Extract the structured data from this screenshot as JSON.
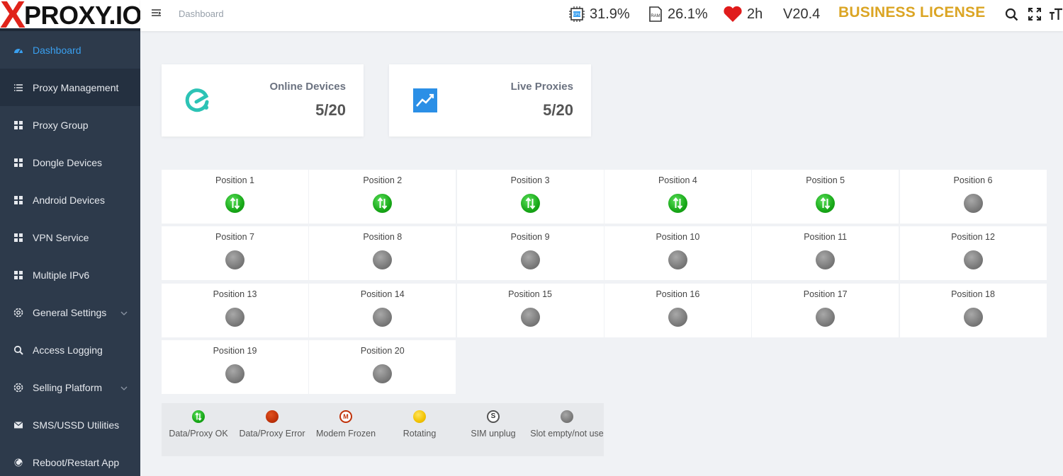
{
  "brand": {
    "logo_x": "X",
    "logo_text": "PROXY.IO"
  },
  "header": {
    "breadcrumb": "Dashboard",
    "cpu": "31.9%",
    "ram": "26.1%",
    "uptime": "2h",
    "version": "V20.4",
    "license": "BUSINESS LICENSE",
    "cpu_chip_label": "CPU",
    "ram_chip_label": "RAM"
  },
  "sidebar": {
    "items": [
      {
        "label": "Dashboard",
        "icon": "dashboard-icon"
      },
      {
        "label": "Proxy Management",
        "icon": "list-icon"
      },
      {
        "label": "Proxy Group",
        "icon": "grid-icon"
      },
      {
        "label": "Dongle Devices",
        "icon": "grid-icon"
      },
      {
        "label": "Android Devices",
        "icon": "grid-icon"
      },
      {
        "label": "VPN Service",
        "icon": "grid-icon"
      },
      {
        "label": "Multiple IPv6",
        "icon": "grid-icon"
      },
      {
        "label": "General Settings",
        "icon": "gear-icon"
      },
      {
        "label": "Access Logging",
        "icon": "search-icon"
      },
      {
        "label": "Selling Platform",
        "icon": "gear-icon"
      },
      {
        "label": "SMS/USSD Utilities",
        "icon": "envelope-icon"
      },
      {
        "label": "Reboot/Restart App",
        "icon": "restart-icon"
      }
    ]
  },
  "cards": {
    "online": {
      "title": "Online Devices",
      "value": "5/20"
    },
    "live": {
      "title": "Live Proxies",
      "value": "5/20"
    }
  },
  "positions": [
    {
      "label": "Position 1",
      "status": "ok"
    },
    {
      "label": "Position 2",
      "status": "ok"
    },
    {
      "label": "Position 3",
      "status": "ok"
    },
    {
      "label": "Position 4",
      "status": "ok"
    },
    {
      "label": "Position 5",
      "status": "ok"
    },
    {
      "label": "Position 6",
      "status": "empty"
    },
    {
      "label": "Position 7",
      "status": "empty"
    },
    {
      "label": "Position 8",
      "status": "empty"
    },
    {
      "label": "Position 9",
      "status": "empty"
    },
    {
      "label": "Position 10",
      "status": "empty"
    },
    {
      "label": "Position 11",
      "status": "empty"
    },
    {
      "label": "Position 12",
      "status": "empty"
    },
    {
      "label": "Position 13",
      "status": "empty"
    },
    {
      "label": "Position 14",
      "status": "empty"
    },
    {
      "label": "Position 15",
      "status": "empty"
    },
    {
      "label": "Position 16",
      "status": "empty"
    },
    {
      "label": "Position 17",
      "status": "empty"
    },
    {
      "label": "Position 18",
      "status": "empty"
    },
    {
      "label": "Position 19",
      "status": "empty"
    },
    {
      "label": "Position 20",
      "status": "empty"
    }
  ],
  "legend": [
    {
      "label": "Data/Proxy OK",
      "kind": "ok"
    },
    {
      "label": "Data/Proxy Error",
      "kind": "error"
    },
    {
      "label": "Modem Frozen",
      "kind": "frozen",
      "glyph": "M"
    },
    {
      "label": "Rotating",
      "kind": "rotating"
    },
    {
      "label": "SIM unplug",
      "kind": "sim",
      "glyph": "S"
    },
    {
      "label": "Slot empty/not use",
      "kind": "empty"
    }
  ],
  "colors": {
    "sidebar_bg": "#2d3a4b",
    "active_link": "#3aa0f0",
    "license": "#dba524",
    "ok_green": "#18a818",
    "error_red": "#c0320a",
    "rotating_yellow": "#f2c200",
    "empty_gray": "#7b7b7b"
  }
}
